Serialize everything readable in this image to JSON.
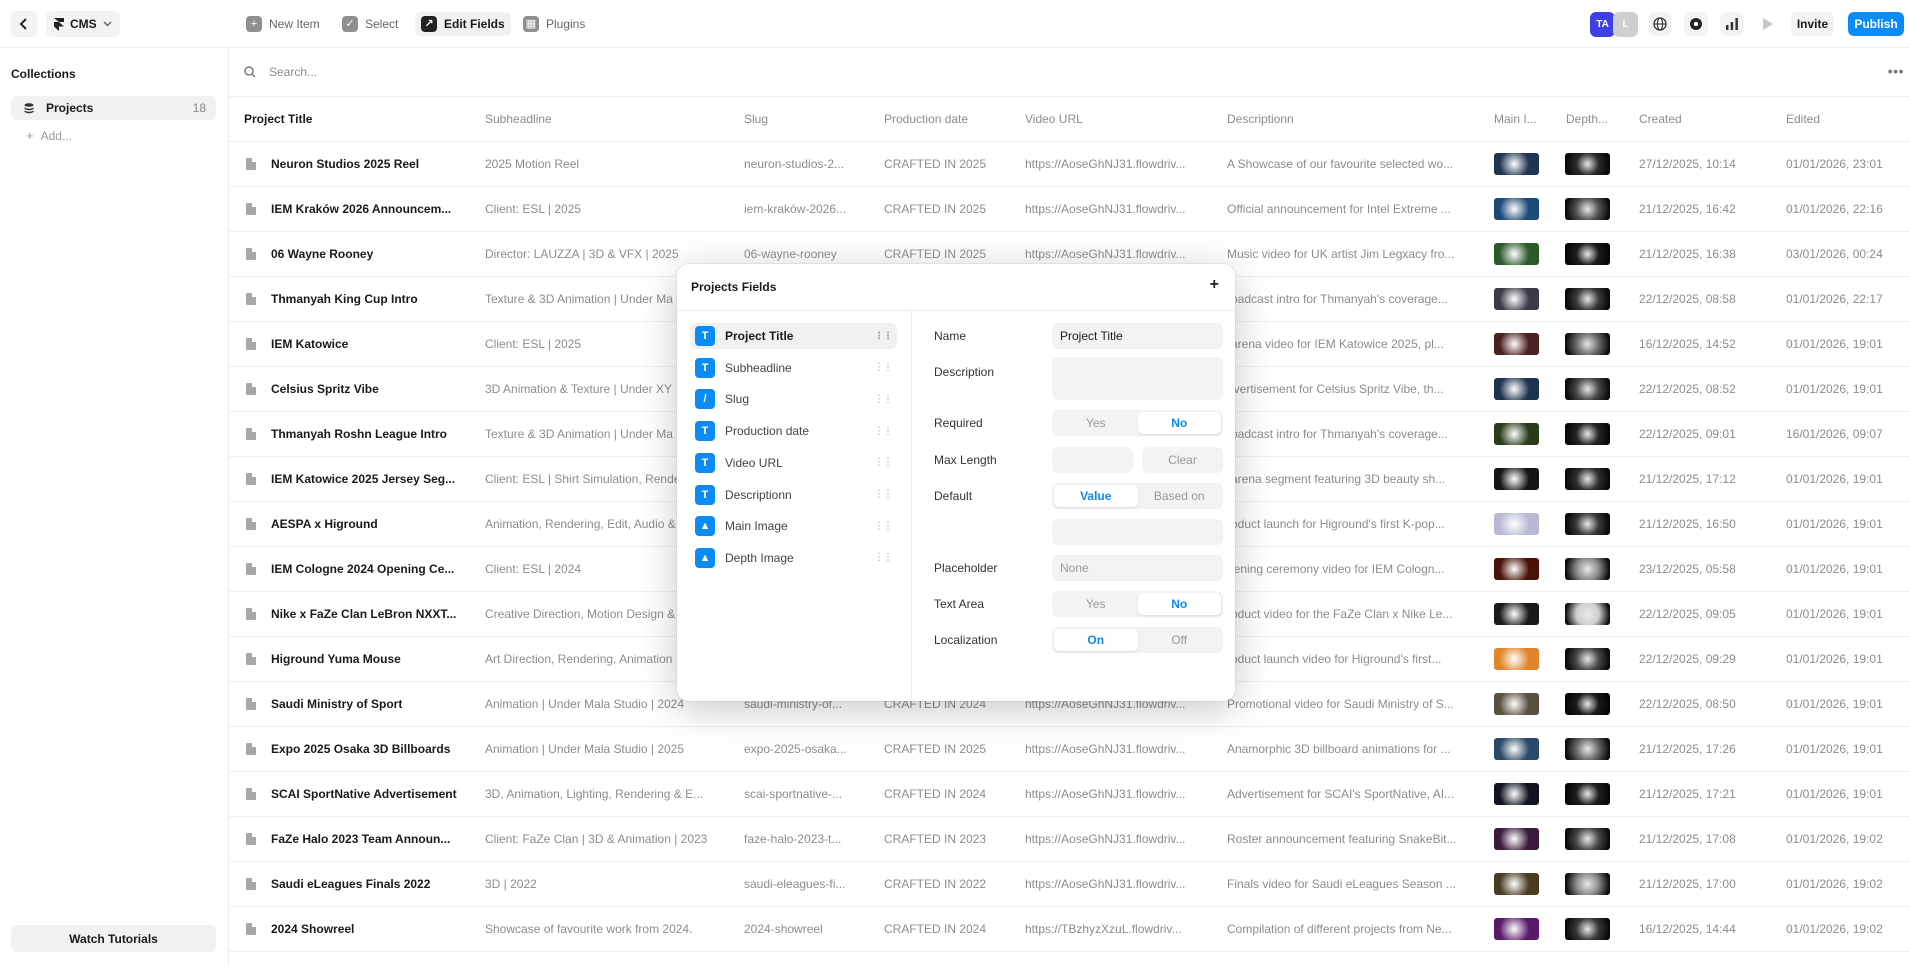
{
  "topbar": {
    "cms_label": "CMS",
    "tools": [
      {
        "label": "New Item",
        "icon": "plus-square-icon"
      },
      {
        "label": "Select",
        "icon": "checkbox-icon"
      },
      {
        "label": "Edit Fields",
        "icon": "edit-arrow-icon"
      },
      {
        "label": "Plugins",
        "icon": "grid-icon"
      }
    ],
    "avatars": [
      "TA",
      "L"
    ],
    "invite_label": "Invite",
    "publish_label": "Publish",
    "accent": "#0b8cf5"
  },
  "sidebar": {
    "title": "Collections",
    "items": [
      {
        "label": "Projects",
        "count": "18"
      }
    ],
    "add_label": "Add...",
    "tutorials_label": "Watch Tutorials"
  },
  "search": {
    "placeholder": "Search..."
  },
  "table": {
    "headers": [
      "Project Title",
      "Subheadline",
      "Slug",
      "Production date",
      "Video URL",
      "Descriptionn",
      "Main I...",
      "Depth...",
      "Created",
      "Edited"
    ],
    "rows": [
      {
        "title": "Neuron Studios 2025 Reel",
        "sub": "2025 Motion Reel",
        "slug": "neuron-studios-2...",
        "date": "CRAFTED IN 2025",
        "url": "https://AoseGhNJ31.flowdriv...",
        "desc": "A Showcase of our favourite selected wo...",
        "created": "27/12/2025, 10:14",
        "edited": "01/01/2026, 23:01",
        "main_color": "#1d3550",
        "depth_color": "#2b2b2b"
      },
      {
        "title": "IEM Kraków 2026 Announcem...",
        "sub": "Client: ESL | 2025",
        "slug": "iem-kraków-2026...",
        "date": "CRAFTED IN 2025",
        "url": "https://AoseGhNJ31.flowdriv...",
        "desc": "Official announcement for Intel Extreme ...",
        "created": "21/12/2025, 16:42",
        "edited": "01/01/2026, 22:16",
        "main_color": "#1b4a78",
        "depth_color": "#555555"
      },
      {
        "title": "06 Wayne Rooney",
        "sub": "Director: LAUZZA | 3D & VFX | 2025",
        "slug": "06-wayne-rooney",
        "date": "CRAFTED IN 2025",
        "url": "https://AoseGhNJ31.flowdriv...",
        "desc": "Music video for UK artist Jim Legxacy fro...",
        "created": "21/12/2025, 16:38",
        "edited": "03/01/2026, 00:24",
        "main_color": "#2a5a2a",
        "depth_color": "#1c1c1c"
      },
      {
        "title": "Thmanyah King Cup Intro",
        "sub": "Texture & 3D Animation | Under Ma",
        "slug": "",
        "date": "",
        "url": "",
        "desc": "roadcast intro for Thmanyah's coverage...",
        "created": "22/12/2025, 08:58",
        "edited": "01/01/2026, 22:17",
        "main_color": "#3b3b48",
        "depth_color": "#3a3a3a"
      },
      {
        "title": "IEM Katowice",
        "sub": "Client: ESL | 2025",
        "slug": "",
        "date": "",
        "url": "",
        "desc": "-arena video for IEM Katowice 2025, pl...",
        "created": "16/12/2025, 14:52",
        "edited": "01/01/2026, 19:01",
        "main_color": "#4a2020",
        "depth_color": "#6a6a6a"
      },
      {
        "title": "Celsius Spritz Vibe",
        "sub": "3D Animation & Texture | Under XY",
        "slug": "",
        "date": "",
        "url": "",
        "desc": "dvertisement for Celsius Spritz Vibe, th...",
        "created": "22/12/2025, 08:52",
        "edited": "01/01/2026, 19:01",
        "main_color": "#1e3350",
        "depth_color": "#4a4a4a"
      },
      {
        "title": "Thmanyah Roshn League Intro",
        "sub": "Texture & 3D Animation | Under Ma",
        "slug": "",
        "date": "",
        "url": "",
        "desc": "roadcast intro for Thmanyah's coverage...",
        "created": "22/12/2025, 09:01",
        "edited": "16/01/2026, 09:07",
        "main_color": "#2a3a1a",
        "depth_color": "#262626"
      },
      {
        "title": "IEM Katowice 2025 Jersey Seg...",
        "sub": "Client: ESL | Shirt Simulation, Rende",
        "slug": "",
        "date": "",
        "url": "",
        "desc": "-arena segment featuring 3D beauty sh...",
        "created": "21/12/2025, 17:12",
        "edited": "01/01/2026, 19:01",
        "main_color": "#141414",
        "depth_color": "#303030"
      },
      {
        "title": "AESPA x Higround",
        "sub": "Animation, Rendering, Edit, Audio &",
        "slug": "",
        "date": "",
        "url": "",
        "desc": "roduct launch for Higround's first K-pop...",
        "created": "21/12/2025, 16:50",
        "edited": "01/01/2026, 19:01",
        "main_color": "#b9b9d6",
        "depth_color": "#3a3a3a"
      },
      {
        "title": "IEM Cologne 2024 Opening Ce...",
        "sub": "Client: ESL | 2024",
        "slug": "",
        "date": "",
        "url": "",
        "desc": "pening ceremony video for IEM Cologn...",
        "created": "23/12/2025, 05:58",
        "edited": "01/01/2026, 19:01",
        "main_color": "#4a1208",
        "depth_color": "#8a8a8a"
      },
      {
        "title": "Nike x FaZe Clan LeBron NXXT...",
        "sub": "Creative Direction, Motion Design &",
        "slug": "",
        "date": "",
        "url": "",
        "desc": "roduct video for the FaZe Clan x Nike Le...",
        "created": "22/12/2025, 09:05",
        "edited": "01/01/2026, 19:01",
        "main_color": "#1a1a1a",
        "depth_color": "#cfcfcf"
      },
      {
        "title": "Higround Yuma Mouse",
        "sub": "Art Direction, Rendering, Animation",
        "slug": "",
        "date": "",
        "url": "",
        "desc": "roduct launch video for Higround's first...",
        "created": "22/12/2025, 09:29",
        "edited": "01/01/2026, 19:01",
        "main_color": "#e0852a",
        "depth_color": "#4a4a4a"
      },
      {
        "title": "Saudi Ministry of Sport",
        "sub": "Animation | Under Mala Studio | 2024",
        "slug": "saudi-ministry-of...",
        "date": "CRAFTED IN 2024",
        "url": "https://AoseGhNJ31.flowdriv...",
        "desc": "Promotional video for Saudi Ministry of S...",
        "created": "22/12/2025, 08:50",
        "edited": "01/01/2026, 19:01",
        "main_color": "#5a5040",
        "depth_color": "#1a1a1a"
      },
      {
        "title": "Expo 2025 Osaka 3D Billboards",
        "sub": "Animation | Under Mala Studio | 2025",
        "slug": "expo-2025-osaka...",
        "date": "CRAFTED IN 2025",
        "url": "https://AoseGhNJ31.flowdriv...",
        "desc": "Anamorphic 3D billboard animations for ...",
        "created": "21/12/2025, 17:26",
        "edited": "01/01/2026, 19:01",
        "main_color": "#2a4a6a",
        "depth_color": "#6a6a6a"
      },
      {
        "title": "SCAI SportNative Advertisement",
        "sub": "3D, Animation, Lighting, Rendering & E...",
        "slug": "scai-sportnative-...",
        "date": "CRAFTED IN 2024",
        "url": "https://AoseGhNJ31.flowdriv...",
        "desc": "Advertisement for SCAI's SportNative, AI...",
        "created": "21/12/2025, 17:21",
        "edited": "01/01/2026, 19:01",
        "main_color": "#101420",
        "depth_color": "#1e1e1e"
      },
      {
        "title": "FaZe Halo 2023 Team Announ...",
        "sub": "Client: FaZe Clan | 3D & Animation | 2023",
        "slug": "faze-halo-2023-t...",
        "date": "CRAFTED IN 2023",
        "url": "https://AoseGhNJ31.flowdriv...",
        "desc": "Roster announcement featuring SnakeBit...",
        "created": "21/12/2025, 17:08",
        "edited": "01/01/2026, 19:02",
        "main_color": "#3a1a3a",
        "depth_color": "#4a4a4a"
      },
      {
        "title": "Saudi eLeagues Finals 2022",
        "sub": "3D | 2022",
        "slug": "saudi-eleagues-fi...",
        "date": "CRAFTED IN 2022",
        "url": "https://AoseGhNJ31.flowdriv...",
        "desc": "Finals video for Saudi eLeagues Season ...",
        "created": "21/12/2025, 17:00",
        "edited": "01/01/2026, 19:02",
        "main_color": "#4a3a20",
        "depth_color": "#8a8a8a"
      },
      {
        "title": "2024 Showreel",
        "sub": "Showcase of favourite work from 2024.",
        "slug": "2024-showreel",
        "date": "CRAFTED IN 2024",
        "url": "https://TBzhyzXzuL.flowdriv...",
        "desc": "Compilation of different projects from Ne...",
        "created": "16/12/2025, 14:44",
        "edited": "01/01/2026, 19:02",
        "main_color": "#5a1a6a",
        "depth_color": "#3a3a3a"
      }
    ]
  },
  "panel": {
    "title": "Projects Fields",
    "plus": "+",
    "fields": [
      {
        "label": "Project Title",
        "glyph": "T",
        "icon": "text-field-icon"
      },
      {
        "label": "Subheadline",
        "glyph": "T",
        "icon": "text-field-icon"
      },
      {
        "label": "Slug",
        "glyph": "/",
        "icon": "slug-field-icon"
      },
      {
        "label": "Production date",
        "glyph": "T",
        "icon": "text-field-icon"
      },
      {
        "label": "Video URL",
        "glyph": "T",
        "icon": "text-field-icon"
      },
      {
        "label": "Descriptionn",
        "glyph": "T",
        "icon": "text-field-icon"
      },
      {
        "label": "Main Image",
        "glyph": "▲",
        "icon": "image-field-icon"
      },
      {
        "label": "Depth Image",
        "glyph": "▲",
        "icon": "image-field-icon"
      }
    ],
    "props": {
      "name_label": "Name",
      "name_value": "Project Title",
      "description_label": "Description",
      "required_label": "Required",
      "yes": "Yes",
      "no": "No",
      "maxlength_label": "Max Length",
      "clear": "Clear",
      "default_label": "Default",
      "value": "Value",
      "based_on": "Based on",
      "placeholder_label": "Placeholder",
      "placeholder_value": "None",
      "textarea_label": "Text Area",
      "localization_label": "Localization",
      "on": "On",
      "off": "Off"
    }
  }
}
